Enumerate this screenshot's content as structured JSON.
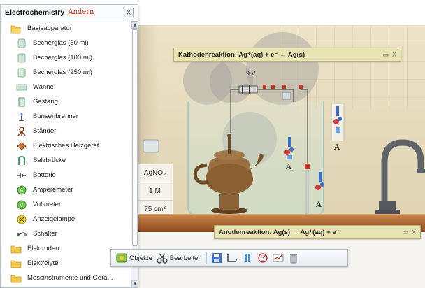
{
  "sidebar": {
    "title": "Electrochemistry",
    "edit_link": "Ändern",
    "close": "X",
    "folders": {
      "apparatus": "Basisapparatur",
      "electrodes": "Elektroden",
      "electrolytes": "Elektrolyte",
      "measuring": "Messinstrumente und Gerä..."
    },
    "items": [
      {
        "label": "Becherglas (50 ml)",
        "icon": "beaker-icon"
      },
      {
        "label": "Becherglas (100 ml)",
        "icon": "beaker-icon"
      },
      {
        "label": "Becherglas (250 ml)",
        "icon": "beaker-icon"
      },
      {
        "label": "Wanne",
        "icon": "trough-icon"
      },
      {
        "label": "Gasfang",
        "icon": "gas-collector-icon"
      },
      {
        "label": "Bunsenbrenner",
        "icon": "bunsen-burner-icon"
      },
      {
        "label": "Ständer",
        "icon": "stand-icon"
      },
      {
        "label": "Elektrisches Heizgerät",
        "icon": "heater-icon"
      },
      {
        "label": "Salzbrücke",
        "icon": "salt-bridge-icon"
      },
      {
        "label": "Batterie",
        "icon": "battery-icon"
      },
      {
        "label": "Amperemeter",
        "icon": "ammeter-icon"
      },
      {
        "label": "Voltmeter",
        "icon": "voltmeter-icon"
      },
      {
        "label": "Anzeigelampe",
        "icon": "lamp-icon"
      },
      {
        "label": "Schalter",
        "icon": "switch-icon"
      }
    ]
  },
  "panels": {
    "cathode": {
      "text": "Kathodenreaktion: Ag⁺(aq) + e⁻ → Ag(s)",
      "minimize": "▭",
      "close": "X"
    },
    "anode": {
      "text": "Anodenreaktion: Ag(s) → Ag⁺(aq) + e⁻",
      "minimize": "▭",
      "close": "X"
    }
  },
  "scene": {
    "voltage": "9 V",
    "solution": {
      "formula": "AgNO₃",
      "concentration": "1 M",
      "volume": "75 cm³"
    },
    "probe_labels": {
      "upper": "A",
      "middle": "A",
      "right": "A"
    }
  },
  "toolbar": {
    "objects": "Objekte",
    "edit": "Bearbeiten"
  },
  "colors": {
    "sidebar_border": "#b9c5d5",
    "edit_link": "#c0392b",
    "panel_bg": "#e8e4b4",
    "counter": "#a8622e",
    "wall": "#e6dbbd"
  }
}
